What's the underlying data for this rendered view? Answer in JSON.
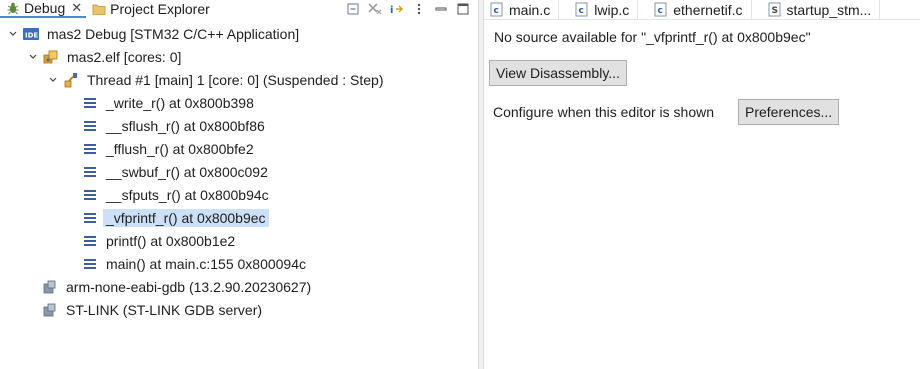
{
  "left": {
    "tabs": [
      {
        "label": "Debug",
        "active": true,
        "closable": true
      },
      {
        "label": "Project Explorer",
        "active": false,
        "closable": false
      }
    ],
    "tree": [
      {
        "label": "mas2 Debug [STM32 C/C++ Application]",
        "icon": "ide-launch-icon"
      },
      {
        "label": "mas2.elf [cores: 0]",
        "icon": "process-icon"
      },
      {
        "label": "Thread #1 [main] 1 [core: 0] (Suspended : Step)",
        "icon": "thread-icon"
      },
      {
        "label": "_write_r() at 0x800b398",
        "icon": "stack-frame-icon"
      },
      {
        "label": "__sflush_r() at 0x800bf86",
        "icon": "stack-frame-icon"
      },
      {
        "label": "_fflush_r() at 0x800bfe2",
        "icon": "stack-frame-icon"
      },
      {
        "label": "__swbuf_r() at 0x800c092",
        "icon": "stack-frame-icon"
      },
      {
        "label": "__sfputs_r() at 0x800b94c",
        "icon": "stack-frame-icon"
      },
      {
        "label": "_vfprintf_r() at 0x800b9ec",
        "icon": "stack-frame-icon",
        "selected": true
      },
      {
        "label": "printf() at 0x800b1e2",
        "icon": "stack-frame-icon"
      },
      {
        "label": "main() at main.c:155 0x800094c",
        "icon": "stack-frame-icon"
      },
      {
        "label": "arm-none-eabi-gdb (13.2.90.20230627)",
        "icon": "gdb-process-icon"
      },
      {
        "label": "ST-LINK (ST-LINK GDB server)",
        "icon": "gdb-process-icon"
      }
    ]
  },
  "right": {
    "tabs": [
      {
        "label": "main.c",
        "icon": "c-file-icon"
      },
      {
        "label": "lwip.c",
        "icon": "c-file-icon"
      },
      {
        "label": "ethernetif.c",
        "icon": "c-file-icon"
      },
      {
        "label": "startup_stm...",
        "icon": "s-file-icon"
      }
    ],
    "message": "No source available for \"_vfprintf_r() at 0x800b9ec\"",
    "disassembly_button": "View Disassembly...",
    "configure_text": "Configure when this editor is shown",
    "preferences_button": "Preferences..."
  },
  "colors": {
    "selection": "#cce0f7",
    "button_bg": "#e1e1e1",
    "accent": "#4a8ad4"
  }
}
